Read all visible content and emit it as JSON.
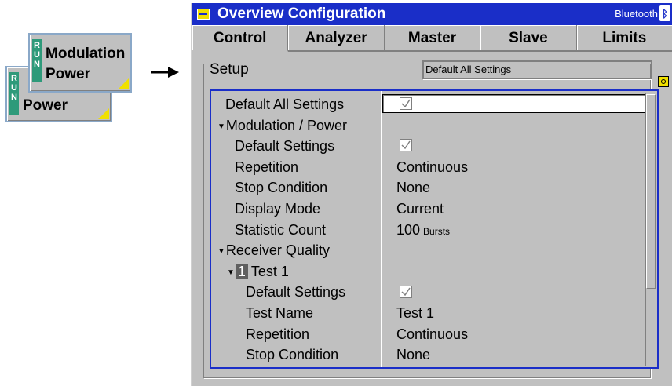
{
  "softkeys": {
    "front": {
      "run": [
        "R",
        "U",
        "N"
      ],
      "lines": [
        "Modulation",
        "Power"
      ]
    },
    "back": {
      "run": [
        "R",
        "U",
        "N"
      ],
      "lines": [
        "Power"
      ]
    }
  },
  "window": {
    "title": "Overview Configuration",
    "mode": "Bluetooth",
    "mode_icon": "bluetooth-icon"
  },
  "tabs": [
    {
      "label": "Control",
      "active": true
    },
    {
      "label": "Analyzer",
      "active": false
    },
    {
      "label": "Master",
      "active": false
    },
    {
      "label": "Slave",
      "active": false
    },
    {
      "label": "Limits",
      "active": false
    }
  ],
  "setup": {
    "title": "Setup",
    "field_value": "Default All Settings"
  },
  "rows": [
    {
      "label": "Default All Settings",
      "value": "",
      "check": true,
      "indent": 0
    },
    {
      "label": "Modulation / Power",
      "value": "",
      "section": true,
      "indent": 0
    },
    {
      "label": "Default Settings",
      "value": "",
      "check": true,
      "indent": 1
    },
    {
      "label": "Repetition",
      "value": "Continuous",
      "indent": 1
    },
    {
      "label": "Stop Condition",
      "value": "None",
      "indent": 1
    },
    {
      "label": "Display Mode",
      "value": "Current",
      "indent": 1
    },
    {
      "label": "Statistic Count",
      "value": "100",
      "unit": "Bursts",
      "indent": 1
    },
    {
      "label": "Receiver Quality",
      "value": "",
      "section": true,
      "indent": 0
    },
    {
      "label": "Test 1",
      "badge": "1",
      "value": "",
      "section": true,
      "indent": 1
    },
    {
      "label": "Default Settings",
      "value": "",
      "check": true,
      "indent": 2
    },
    {
      "label": "Test Name",
      "value": "Test 1",
      "indent": 2
    },
    {
      "label": "Repetition",
      "value": "Continuous",
      "indent": 2
    },
    {
      "label": "Stop Condition",
      "value": "None",
      "indent": 2
    }
  ],
  "colors": {
    "title_bar": "#1a2ec8",
    "panel": "#c0c0c0",
    "run_strip": "#2e9a7a",
    "accent_yellow": "#f0e000"
  }
}
